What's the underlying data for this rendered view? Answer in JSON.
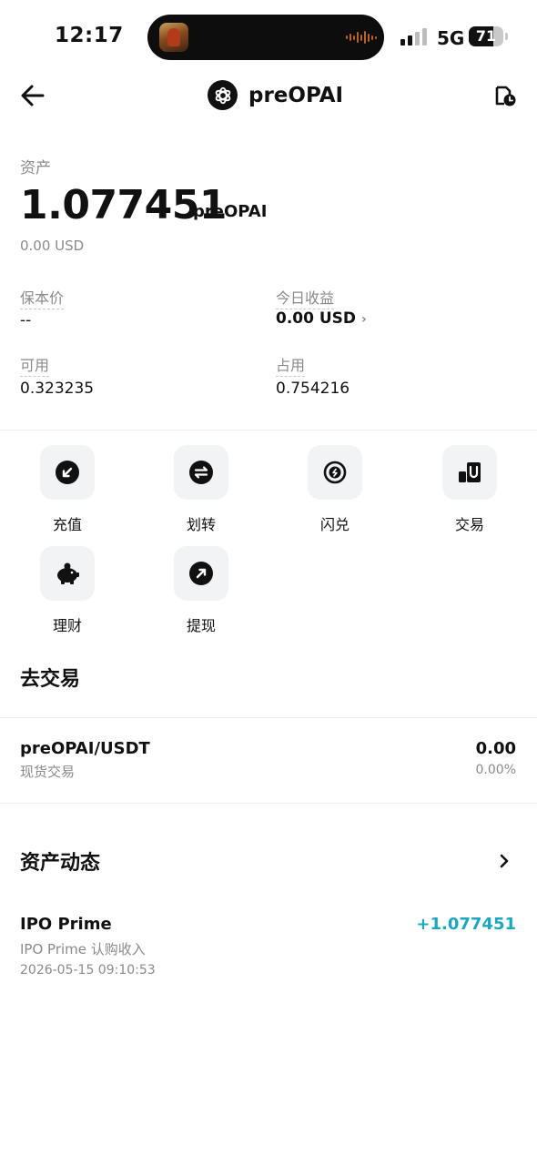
{
  "status_bar": {
    "time": "12:17",
    "network": "5G",
    "battery": "71",
    "battery_level": 0.71
  },
  "header": {
    "title": "preOPAI",
    "back_icon": "arrow-left-icon",
    "coin_icon": "openai-logo-icon",
    "history_icon": "history-clock-icon"
  },
  "asset": {
    "label": "资产",
    "amount": "1.077451",
    "unit": "preOPAI",
    "usd_value": "0.00 USD"
  },
  "stats": {
    "cost_price_label": "保本价",
    "cost_price_value": "--",
    "today_pnl_label": "今日收益",
    "today_pnl_value": "0.00 USD",
    "available_label": "可用",
    "available_value": "0.323235",
    "occupied_label": "占用",
    "occupied_value": "0.754216"
  },
  "actions": [
    {
      "label": "充值",
      "icon": "deposit-icon"
    },
    {
      "label": "划转",
      "icon": "transfer-icon"
    },
    {
      "label": "闪兑",
      "icon": "swap-icon"
    },
    {
      "label": "交易",
      "icon": "trade-icon"
    },
    {
      "label": "理财",
      "icon": "piggy-bank-icon"
    },
    {
      "label": "提现",
      "icon": "withdraw-icon"
    }
  ],
  "trade_section": {
    "title": "去交易",
    "pair": {
      "name": "preOPAI/USDT",
      "type": "现货交易",
      "price": "0.00",
      "change": "0.00%"
    }
  },
  "activity_section": {
    "title": "资产动态",
    "items": [
      {
        "title": "IPO Prime",
        "description": "IPO Prime 认购收入",
        "time": "2026-05-15 09:10:53",
        "amount": "+1.077451"
      }
    ]
  },
  "colors": {
    "positive": "#19a8c0",
    "muted": "#8a8a8a",
    "icon_bg": "#f2f3f5"
  }
}
